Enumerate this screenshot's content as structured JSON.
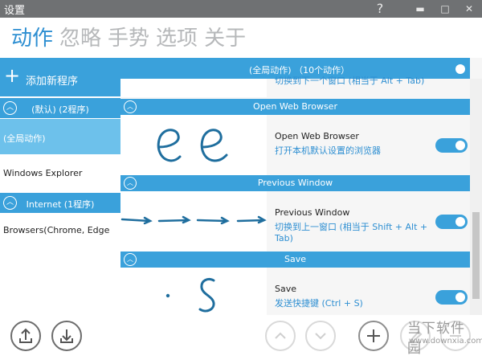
{
  "window": {
    "title": "设置",
    "help": "?",
    "minimize": "▬",
    "maximize": "□",
    "close": "✕"
  },
  "tabs": [
    {
      "label": "动作",
      "active": true
    },
    {
      "label": "忽略",
      "active": false
    },
    {
      "label": "手势",
      "active": false
    },
    {
      "label": "选项",
      "active": false
    },
    {
      "label": "关于",
      "active": false
    }
  ],
  "sidebar": {
    "add_program": "添加新程序",
    "groups": [
      {
        "label": "(默认) (2程序)"
      },
      {
        "label": "Internet (1程序)"
      }
    ],
    "items": [
      {
        "label": "(全局动作)",
        "selected": true
      },
      {
        "label": "Windows Explorer",
        "selected": false
      },
      {
        "label": "Browsers(Chrome, Edge",
        "selected": false
      }
    ]
  },
  "main": {
    "global_bar": {
      "label": "(全局动作)  （10个动作）",
      "enabled": true
    },
    "cut_item_text": "切换到下一个窗口 (相当于 Alt + Tab)",
    "sections": [
      {
        "header": "Open Web Browser",
        "name": "Open Web Browser",
        "description": "打开本机默认设置的浏览器",
        "enabled": true
      },
      {
        "header": "Previous Window",
        "name": "Previous Window",
        "description": "切换到上一窗口 (相当于 Shift + Alt + Tab)",
        "enabled": true
      },
      {
        "header": "Save",
        "name": "Save",
        "description": "发送快捷键 (Ctrl + S)",
        "enabled": true
      }
    ]
  },
  "bottom": {
    "import_icon": "upload-icon",
    "export_icon": "download-icon",
    "move_up_icon": "chevron-up-icon",
    "move_down_icon": "chevron-down-icon",
    "add_icon": "plus-icon",
    "edit_icon": "pencil-icon",
    "delete_icon": "minus-icon"
  },
  "watermark": {
    "cn": "当下软件园",
    "en": "www.downxia.com"
  },
  "colors": {
    "accent": "#3aa1db",
    "selected": "#6dc1eb",
    "titlebar": "#6f7173",
    "link": "#2e8fd2"
  }
}
